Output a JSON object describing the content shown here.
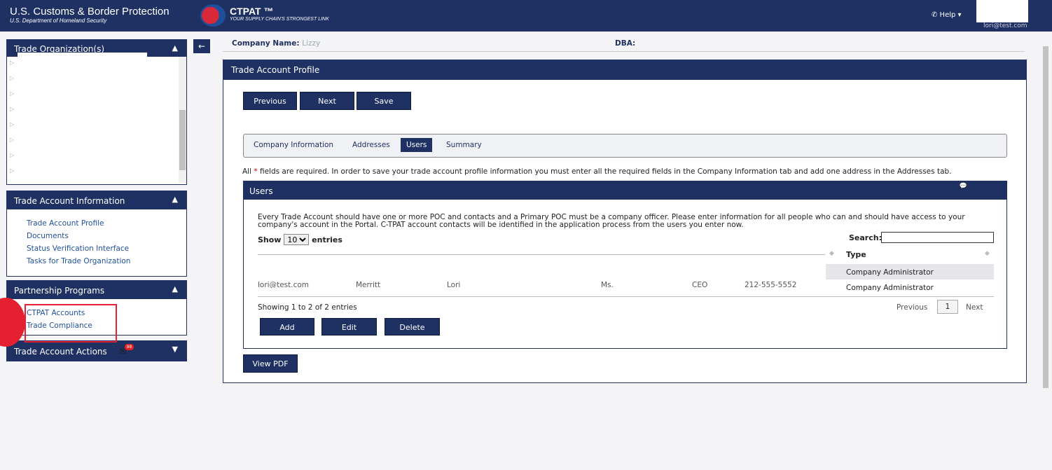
{
  "header": {
    "agency_title": "U.S. Customs & Border Protection",
    "agency_subtitle": "U.S. Department of Homeland Security",
    "ctpat_title": "CTPAT ™",
    "ctpat_subtitle": "YOUR SUPPLY CHAIN'S STRONGEST LINK",
    "help_label": "✆ Help ▾",
    "user_email": "lori@test.com"
  },
  "sidebar": {
    "trade_org_title": "Trade Organization(s)",
    "trade_account_info_title": "Trade Account Information",
    "trade_account_links": [
      "Trade Account Profile",
      "Documents",
      "Status Verification Interface",
      "Tasks for Trade Organization"
    ],
    "partnership_title": "Partnership Programs",
    "partnership_links": [
      "CTPAT Accounts",
      "Trade Compliance"
    ],
    "actions_title": "Trade Account Actions",
    "actions_badge": "98"
  },
  "company": {
    "name_label": "Company Name:",
    "name_value": "Lizzy",
    "dba_label": "DBA:"
  },
  "profile": {
    "title": "Trade Account Profile",
    "buttons": {
      "previous": "Previous",
      "next": "Next",
      "save": "Save"
    },
    "tabs": [
      "Company Information",
      "Addresses",
      "Users",
      "Summary"
    ],
    "active_tab": "Users",
    "required_star": "*",
    "required_pre": "All",
    "required_note": "fields are required. In order to save your trade account profile information you must enter all the required fields in the Company Information tab and add one address in the Addresses tab."
  },
  "users": {
    "title": "Users",
    "description": "Every Trade Account should have one or more POC and contacts and a Primary POC must be a company officer. Please enter information for all people who can and should have access to your company's account in the Portal. C-TPAT account contacts will be identified in the application process from the users you enter now.",
    "show_label": "Show",
    "entries_label": "entries",
    "page_size": "10",
    "search_label": "Search:",
    "type_header": "Type",
    "rows": [
      {
        "email": "",
        "last": "",
        "first": "",
        "salutation": "",
        "title": "",
        "phone": "",
        "type": "Company Administrator"
      },
      {
        "email": "lori@test.com",
        "last": "Merritt",
        "first": "Lori",
        "salutation": "Ms.",
        "title": "CEO",
        "phone": "212-555-5552",
        "type": "Company Administrator"
      }
    ],
    "showing": "Showing 1 to 2 of 2 entries",
    "pager_prev": "Previous",
    "pager_page": "1",
    "pager_next": "Next",
    "btn_add": "Add",
    "btn_edit": "Edit",
    "btn_delete": "Delete"
  },
  "view_pdf": "View PDF",
  "colors": {
    "navy": "#1f3163",
    "link": "#1f4f9a",
    "highlight": "#e52030"
  }
}
